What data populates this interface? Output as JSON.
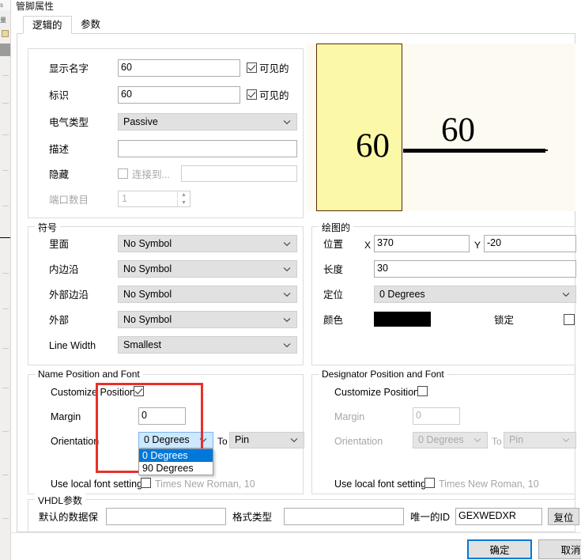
{
  "window": {
    "title": "管脚属性"
  },
  "tabs": [
    {
      "label": "逻辑的",
      "active": true
    },
    {
      "label": "参数",
      "active": false
    }
  ],
  "logical": {
    "display_name": {
      "label": "显示名字",
      "value": "60",
      "visible_label": "可见的",
      "visible_checked": true
    },
    "designator": {
      "label": "标识",
      "value": "60",
      "visible_label": "可见的",
      "visible_checked": true
    },
    "electrical_type": {
      "label": "电气类型",
      "value": "Passive"
    },
    "description": {
      "label": "描述",
      "value": "",
      "placeholder": ""
    },
    "hidden": {
      "label": "隐藏",
      "connect_to_label": "连接到...",
      "connect_to_checked": false,
      "connect_to_value": "",
      "connect_to_placeholder": ""
    },
    "port_count": {
      "label": "端口数目",
      "value": "1"
    }
  },
  "symbol": {
    "legend": "符号",
    "rows": [
      {
        "label": "里面",
        "value": "No Symbol"
      },
      {
        "label": "内边沿",
        "value": "No Symbol"
      },
      {
        "label": "外部边沿",
        "value": "No Symbol"
      },
      {
        "label": "外部",
        "value": "No Symbol"
      },
      {
        "label": "Line Width",
        "value": "Smallest"
      }
    ]
  },
  "graphical": {
    "legend": "绘图的",
    "location": {
      "label": "位置",
      "x_label": "X",
      "x_value": "370",
      "y_label": "Y",
      "y_value": "-20"
    },
    "length": {
      "label": "长度",
      "value": "30"
    },
    "orientation": {
      "label": "定位",
      "value": "0 Degrees"
    },
    "color": {
      "label": "颜色",
      "hex": "#000000"
    },
    "locked": {
      "label": "锁定",
      "checked": false
    }
  },
  "name_position_font": {
    "legend": "Name Position and Font",
    "customize_position": {
      "label": "Customize Position",
      "checked": true
    },
    "margin": {
      "label": "Margin",
      "value": "0"
    },
    "orientation": {
      "label": "Orientation",
      "value": "0 Degrees",
      "to_label": "To",
      "to_value": "Pin",
      "open": true,
      "options": [
        {
          "label": "0 Degrees",
          "selected": true
        },
        {
          "label": "90 Degrees",
          "selected": false
        }
      ]
    },
    "use_local_font": {
      "label": "Use local font setting",
      "checked": false,
      "font_text": "Times New Roman, 10"
    }
  },
  "designator_position_font": {
    "legend": "Designator Position and Font",
    "customize_position": {
      "label": "Customize Position",
      "checked": false
    },
    "margin": {
      "label": "Margin",
      "value": "0"
    },
    "orientation": {
      "label": "Orientation",
      "value": "0 Degrees",
      "to_label": "To",
      "to_value": "Pin"
    },
    "use_local_font": {
      "label": "Use local font setting",
      "checked": false,
      "font_text": "Times New Roman, 10"
    }
  },
  "vhdl": {
    "legend": "VHDL参数",
    "default_data": {
      "label": "默认的数据保",
      "value": ""
    },
    "format_type": {
      "label": "格式类型",
      "value": ""
    },
    "unique_id": {
      "label": "唯一的ID",
      "value": "GEXWEDXR"
    },
    "reset_button": "复位"
  },
  "preview": {
    "pin_name": "60",
    "pin_designator": "60",
    "body_color": "#fbf8a8",
    "body_border": "#5c2a07",
    "background": "#fdfaf2"
  },
  "annotation": {
    "highlight_color": "#e8302a"
  },
  "footer": {
    "ok_button": "确定",
    "cancel_button": "取消"
  },
  "icons": {
    "chevron_down": "⌄",
    "spin_up": "▲",
    "spin_down": "▼"
  }
}
